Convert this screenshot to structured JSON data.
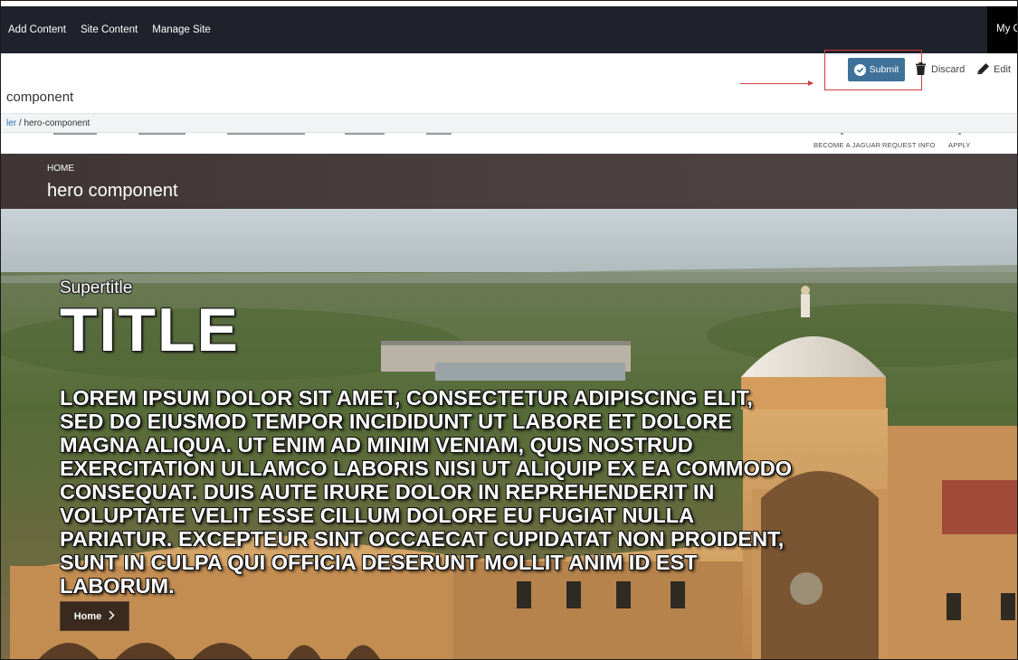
{
  "admin_bar": {
    "menu": [
      "Add Content",
      "Site Content",
      "Manage Site"
    ],
    "right_label": "My C"
  },
  "toolbar": {
    "page_title": "component",
    "submit_label": "Submit",
    "discard_label": "Discard",
    "edit_label": "Edit"
  },
  "breadcrumb": {
    "parent": "ler",
    "separator": "/",
    "current": "hero-component"
  },
  "site_nav": {
    "utility": [
      "BECOME A JAGUAR",
      "REQUEST INFO",
      "APPLY"
    ]
  },
  "page_header": {
    "crumb": "HOME",
    "title": "hero component"
  },
  "hero": {
    "supertitle": "Supertitle",
    "title": "TITLE",
    "body": "LOREM IPSUM DOLOR SIT AMET, CONSECTETUR ADIPISCING ELIT, SED DO EIUSMOD TEMPOR INCIDIDUNT UT LABORE ET DOLORE MAGNA ALIQUA. UT ENIM AD MINIM VENIAM, QUIS NOSTRUD EXERCITATION ULLAMCO LABORIS NISI UT ALIQUIP EX EA COMMODO CONSEQUAT. DUIS AUTE IRURE DOLOR IN REPREHENDERIT IN VOLUPTATE VELIT ESSE CILLUM DOLORE EU FUGIAT NULLA PARIATUR. EXCEPTEUR SINT OCCAECAT CUPIDATAT NON PROIDENT, SUNT IN CULPA QUI OFFICIA DESERUNT MOLLIT ANIM ID EST LABORUM.",
    "button_label": "Home",
    "button_icon": "chevron-right-icon"
  },
  "colors": {
    "admin_bar": "#1f212b",
    "submit": "#3f7199",
    "highlight": "#d43b3b",
    "header": "#4a3f3f",
    "hero_button": "#3a2a1e"
  }
}
